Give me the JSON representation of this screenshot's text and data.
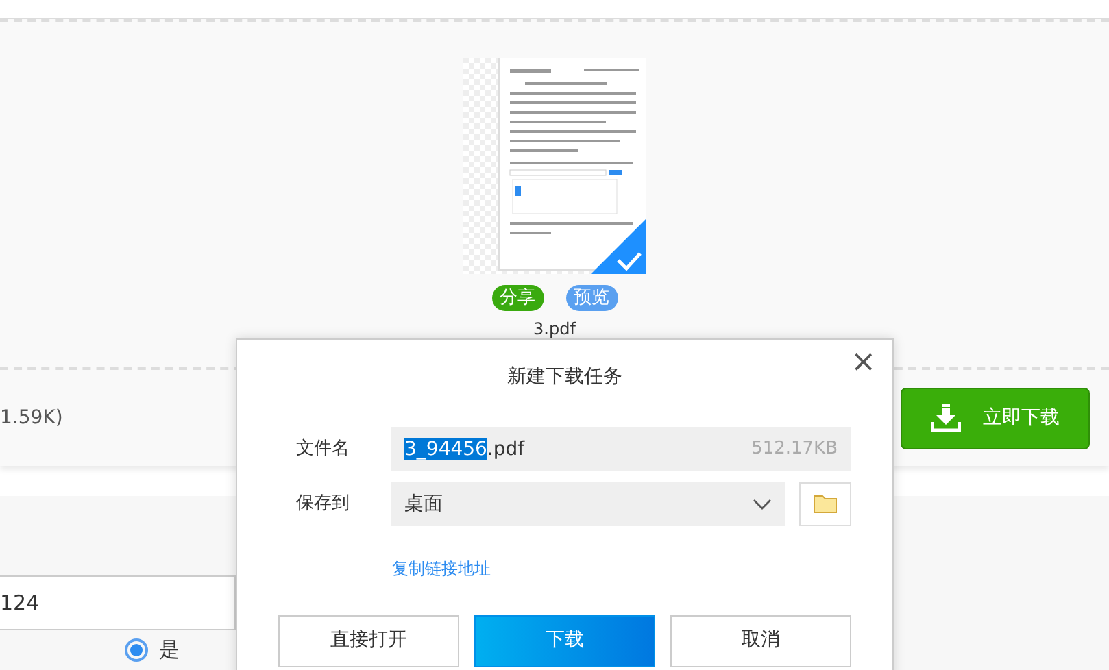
{
  "file_card": {
    "name": "3.pdf",
    "selected": true,
    "actions": [
      {
        "label": "分享",
        "kind": "share"
      },
      {
        "label": "预览",
        "kind": "preview"
      }
    ]
  },
  "download_bar": {
    "size_text": "1.59K)",
    "button": "立即下载"
  },
  "form": {
    "field_value": "124",
    "radio": {
      "label": "是",
      "selected": true
    }
  },
  "dialog": {
    "title": "新建下载任务",
    "close": "×",
    "filename": {
      "label": "文件名",
      "highlighted": "3_94456",
      "rest": ".pdf",
      "size": "512.17KB"
    },
    "save_to": {
      "label": "保存到",
      "value": "桌面"
    },
    "link": "复制链接地址",
    "buttons": [
      {
        "label": "直接打开",
        "kind": "plain"
      },
      {
        "label": "下载",
        "kind": "primary"
      },
      {
        "label": "取消",
        "kind": "plain"
      }
    ]
  }
}
